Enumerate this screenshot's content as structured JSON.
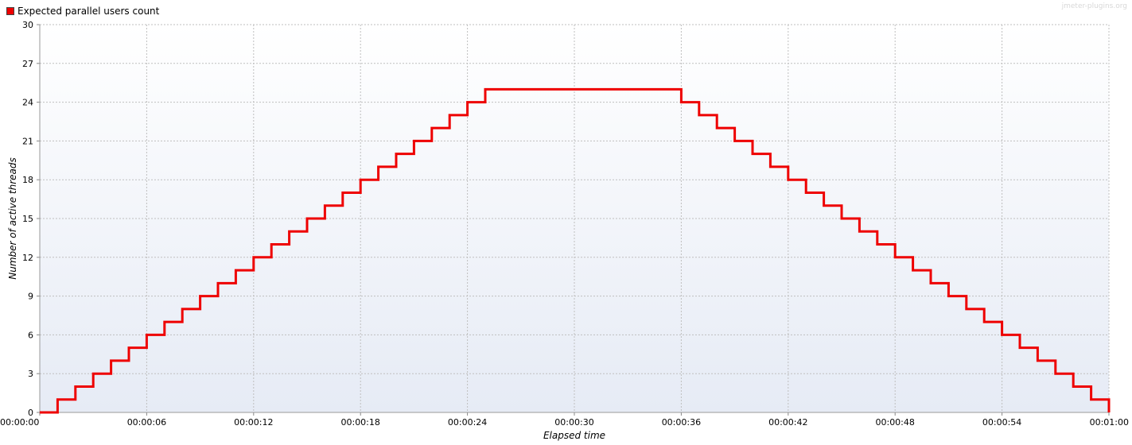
{
  "chart_data": {
    "type": "line",
    "line_shape": "step",
    "xlabel": "Elapsed time",
    "ylabel": "Number of active threads",
    "ylim": [
      0,
      30
    ],
    "yticks": [
      0,
      3,
      6,
      9,
      12,
      15,
      18,
      21,
      24,
      27,
      30
    ],
    "xlim_seconds": [
      0,
      60
    ],
    "xticks": [
      {
        "t": 0,
        "label": "00:00:00"
      },
      {
        "t": 6,
        "label": "00:00:06"
      },
      {
        "t": 12,
        "label": "00:00:12"
      },
      {
        "t": 18,
        "label": "00:00:18"
      },
      {
        "t": 24,
        "label": "00:00:24"
      },
      {
        "t": 30,
        "label": "00:00:30"
      },
      {
        "t": 36,
        "label": "00:00:36"
      },
      {
        "t": 42,
        "label": "00:00:42"
      },
      {
        "t": 48,
        "label": "00:00:48"
      },
      {
        "t": 54,
        "label": "00:00:54"
      },
      {
        "t": 60,
        "label": "00:01:00"
      }
    ],
    "grid": true,
    "legend_position": "top-left",
    "series": [
      {
        "name": "Expected parallel users count",
        "color": "#ee0000",
        "x": [
          0,
          1,
          2,
          3,
          4,
          5,
          6,
          7,
          8,
          9,
          10,
          11,
          12,
          13,
          14,
          15,
          16,
          17,
          18,
          19,
          20,
          21,
          22,
          23,
          24,
          25,
          36,
          37,
          38,
          39,
          40,
          41,
          42,
          43,
          44,
          45,
          46,
          47,
          48,
          49,
          50,
          51,
          52,
          53,
          54,
          55,
          56,
          57,
          58,
          59,
          60
        ],
        "y": [
          0,
          1,
          2,
          3,
          4,
          5,
          6,
          7,
          8,
          9,
          10,
          11,
          12,
          13,
          14,
          15,
          16,
          17,
          18,
          19,
          20,
          21,
          22,
          23,
          24,
          25,
          24,
          23,
          22,
          21,
          20,
          19,
          18,
          17,
          16,
          15,
          14,
          13,
          12,
          11,
          10,
          9,
          8,
          7,
          6,
          5,
          4,
          3,
          2,
          1,
          0
        ]
      }
    ]
  },
  "watermark": "jmeter-plugins.org"
}
